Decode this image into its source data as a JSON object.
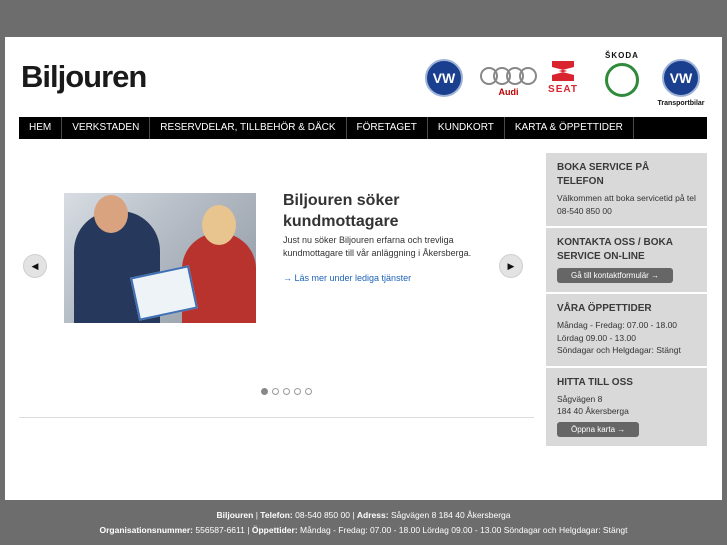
{
  "header": {
    "logo_text": "Biljouren",
    "brands": {
      "vw": "VW",
      "audi": "Audi",
      "seat": "SEAT",
      "skoda": "ŠKODA",
      "transport": "Transportbilar"
    }
  },
  "nav": {
    "items": [
      "HEM",
      "VERKSTADEN",
      "RESERVDELAR, TILLBEHÖR & DÄCK",
      "FÖRETAGET",
      "KUNDKORT",
      "KARTA & ÖPPETTIDER"
    ]
  },
  "slide": {
    "title": "Biljouren söker kundmottagare",
    "text": "Just nu söker Biljouren erfarna och trevliga kundmottagare till vår anläggning i Åkersberga.",
    "link": "→ Läs mer under lediga tjänster",
    "prev_glyph": "◀",
    "next_glyph": "▶",
    "dot_count": 5,
    "active_dot": 1
  },
  "sidebar": {
    "boka": {
      "title": "BOKA SERVICE PÅ TELEFON",
      "text": "Välkommen att boka servicetid på tel 08-540 850 00"
    },
    "kontakta": {
      "title": "KONTAKTA OSS / BOKA SERVICE ON-LINE",
      "button": "Gå till kontaktformulär →"
    },
    "oppettider": {
      "title": "VÅRA ÖPPETTIDER",
      "line1": "Måndag - Fredag: 07.00 - 18.00",
      "line2": "Lördag 09.00 - 13.00",
      "line3": "Söndagar och Helgdagar: Stängt"
    },
    "hitta": {
      "title": "HITTA TILL OSS",
      "line1": "Sågvägen 8",
      "line2": "184 40 Åkersberga",
      "button": "Öppna karta →"
    }
  },
  "footer": {
    "company": "Biljouren",
    "sep": "|",
    "phone_label": "Telefon:",
    "phone": "08-540 850 00",
    "address_label": "Adress:",
    "address": "Sågvägen 8 184 40 Åkersberga",
    "org_label": "Organisationsnummer:",
    "org": "556587-6611",
    "hours_label": "Öppettider:",
    "hours": "Måndag - Fredag: 07.00 - 18.00 Lördag 09.00 - 13.00 Söndagar och Helgdagar: Stängt"
  }
}
